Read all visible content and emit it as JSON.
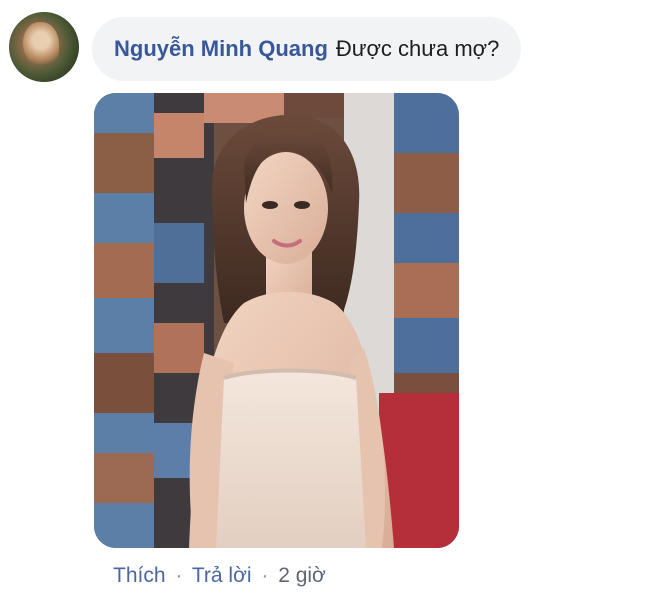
{
  "comment": {
    "author": "Nguyễn Minh Quang",
    "text": "Được chưa mợ?",
    "actions": {
      "like": "Thích",
      "reply": "Trả lời",
      "separator": "·",
      "time": "2 giờ"
    }
  },
  "colors": {
    "author_link": "#385898",
    "action_link": "#4b67a1",
    "bubble_bg": "#f2f3f5"
  }
}
